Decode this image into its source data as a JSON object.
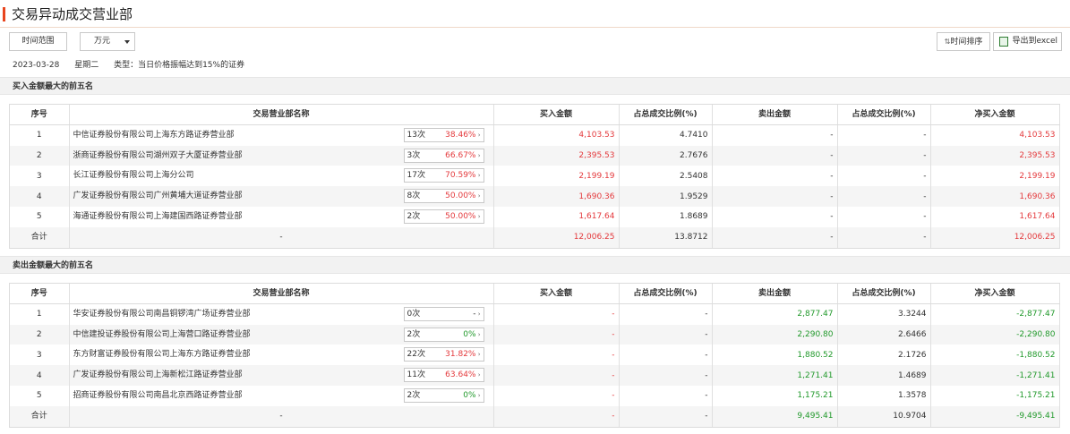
{
  "page": {
    "title": "交易异动成交营业部"
  },
  "toolbar": {
    "range_label": "时间范围",
    "unit_value": "万元",
    "sort_label": "时间排序",
    "export_label": "导出到excel"
  },
  "info": {
    "date": "2023-03-28",
    "weekday": "星期二",
    "type": "类型：当日价格振幅达到15%的证券"
  },
  "buy_section": {
    "title": "买入金额最大的前五名",
    "headers": [
      "序号",
      "交易营业部名称",
      "买入金额",
      "占总成交比例(%)",
      "卖出金额",
      "占总成交比例(%)",
      "净买入金额"
    ],
    "rows": [
      {
        "no": "1",
        "name": "中信证券股份有限公司上海东方路证券营业部",
        "count": "13次",
        "pct": "38.46%",
        "buy": "4,103.53",
        "buy_ratio": "4.7410",
        "sell": "-",
        "sell_ratio": "-",
        "net": "4,103.53"
      },
      {
        "no": "2",
        "name": "浙商证券股份有限公司湖州双子大厦证券营业部",
        "count": "3次",
        "pct": "66.67%",
        "buy": "2,395.53",
        "buy_ratio": "2.7676",
        "sell": "-",
        "sell_ratio": "-",
        "net": "2,395.53"
      },
      {
        "no": "3",
        "name": "长江证券股份有限公司上海分公司",
        "count": "17次",
        "pct": "70.59%",
        "buy": "2,199.19",
        "buy_ratio": "2.5408",
        "sell": "-",
        "sell_ratio": "-",
        "net": "2,199.19"
      },
      {
        "no": "4",
        "name": "广发证券股份有限公司广州黄埔大道证券营业部",
        "count": "8次",
        "pct": "50.00%",
        "buy": "1,690.36",
        "buy_ratio": "1.9529",
        "sell": "-",
        "sell_ratio": "-",
        "net": "1,690.36"
      },
      {
        "no": "5",
        "name": "海通证券股份有限公司上海建国西路证券营业部",
        "count": "2次",
        "pct": "50.00%",
        "buy": "1,617.64",
        "buy_ratio": "1.8689",
        "sell": "-",
        "sell_ratio": "-",
        "net": "1,617.64"
      }
    ],
    "total": {
      "label": "合计",
      "name": "-",
      "buy": "12,006.25",
      "buy_ratio": "13.8712",
      "sell": "-",
      "sell_ratio": "-",
      "net": "12,006.25"
    }
  },
  "sell_section": {
    "title": "卖出金额最大的前五名",
    "headers": [
      "序号",
      "交易营业部名称",
      "买入金额",
      "占总成交比例(%)",
      "卖出金额",
      "占总成交比例(%)",
      "净买入金额"
    ],
    "rows": [
      {
        "no": "1",
        "name": "华安证券股份有限公司南昌铜锣湾广场证券营业部",
        "count": "0次",
        "pct": "-",
        "buy": "-",
        "buy_ratio": "-",
        "sell": "2,877.47",
        "sell_ratio": "3.3244",
        "net": "-2,877.47"
      },
      {
        "no": "2",
        "name": "中信建投证券股份有限公司上海营口路证券营业部",
        "count": "2次",
        "pct": "0%",
        "buy": "-",
        "buy_ratio": "-",
        "sell": "2,290.80",
        "sell_ratio": "2.6466",
        "net": "-2,290.80"
      },
      {
        "no": "3",
        "name": "东方财富证券股份有限公司上海东方路证券营业部",
        "count": "22次",
        "pct": "31.82%",
        "buy": "-",
        "buy_ratio": "-",
        "sell": "1,880.52",
        "sell_ratio": "2.1726",
        "net": "-1,880.52"
      },
      {
        "no": "4",
        "name": "广发证券股份有限公司上海新松江路证券营业部",
        "count": "11次",
        "pct": "63.64%",
        "buy": "-",
        "buy_ratio": "-",
        "sell": "1,271.41",
        "sell_ratio": "1.4689",
        "net": "-1,271.41"
      },
      {
        "no": "5",
        "name": "招商证券股份有限公司南昌北京西路证券营业部",
        "count": "2次",
        "pct": "0%",
        "buy": "-",
        "buy_ratio": "-",
        "sell": "1,175.21",
        "sell_ratio": "1.3578",
        "net": "-1,175.21"
      }
    ],
    "total": {
      "label": "合计",
      "name": "-",
      "buy": "-",
      "buy_ratio": "-",
      "sell": "9,495.41",
      "sell_ratio": "10.9704",
      "net": "-9,495.41"
    }
  },
  "colors": {
    "accent": "#e8451e",
    "up": "#e4393c",
    "down": "#21992b"
  }
}
